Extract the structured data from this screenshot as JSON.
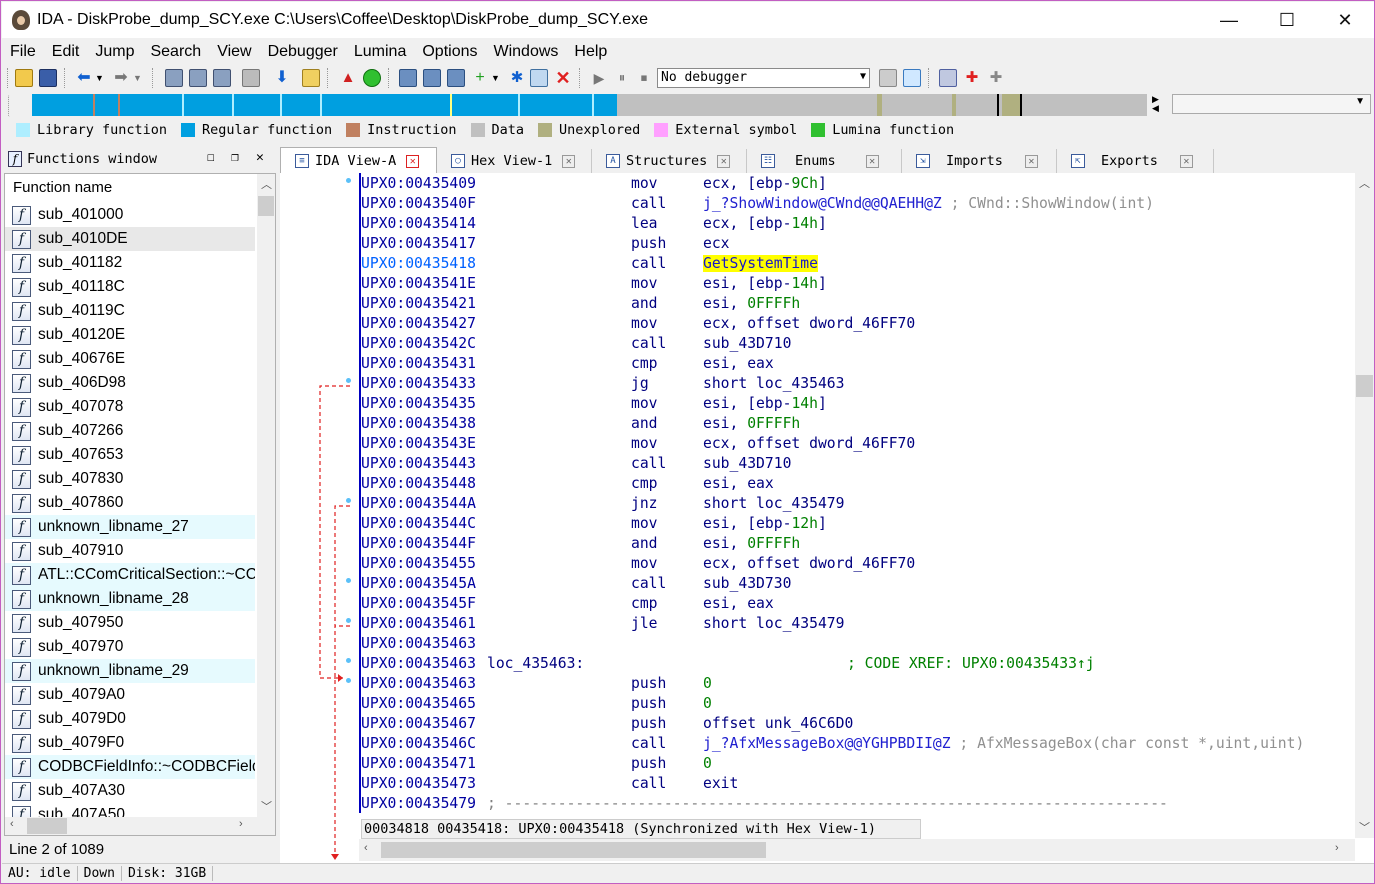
{
  "window": {
    "title": "IDA - DiskProbe_dump_SCY.exe C:\\Users\\Coffee\\Desktop\\DiskProbe_dump_SCY.exe",
    "minimize": "—",
    "maximize": "☐",
    "close": "✕"
  },
  "menu": [
    "File",
    "Edit",
    "Jump",
    "Search",
    "View",
    "Debugger",
    "Lumina",
    "Options",
    "Windows",
    "Help"
  ],
  "toolbar": {
    "debugger_select": "No debugger"
  },
  "legend": [
    {
      "label": "Library function",
      "color": "#aeeeff"
    },
    {
      "label": "Regular function",
      "color": "#009fe0"
    },
    {
      "label": "Instruction",
      "color": "#c08060"
    },
    {
      "label": "Data",
      "color": "#c0c0c0"
    },
    {
      "label": "Unexplored",
      "color": "#b0b080"
    },
    {
      "label": "External symbol",
      "color": "#ffa0ff"
    },
    {
      "label": "Lumina function",
      "color": "#30c030"
    }
  ],
  "functions_window": {
    "title": "Functions window",
    "column": "Function name",
    "items": [
      {
        "name": "sub_401000",
        "lib": false
      },
      {
        "name": "sub_4010DE",
        "lib": false,
        "selected": true
      },
      {
        "name": "sub_401182",
        "lib": false
      },
      {
        "name": "sub_40118C",
        "lib": false
      },
      {
        "name": "sub_40119C",
        "lib": false
      },
      {
        "name": "sub_40120E",
        "lib": false
      },
      {
        "name": "sub_40676E",
        "lib": false
      },
      {
        "name": "sub_406D98",
        "lib": false
      },
      {
        "name": "sub_407078",
        "lib": false
      },
      {
        "name": "sub_407266",
        "lib": false
      },
      {
        "name": "sub_407653",
        "lib": false
      },
      {
        "name": "sub_407830",
        "lib": false
      },
      {
        "name": "sub_407860",
        "lib": false
      },
      {
        "name": "unknown_libname_27",
        "lib": true
      },
      {
        "name": "sub_407910",
        "lib": false
      },
      {
        "name": "ATL::CComCriticalSection::~CComCriticalSection(void)",
        "lib": true
      },
      {
        "name": "unknown_libname_28",
        "lib": true
      },
      {
        "name": "sub_407950",
        "lib": false
      },
      {
        "name": "sub_407970",
        "lib": false
      },
      {
        "name": "unknown_libname_29",
        "lib": true
      },
      {
        "name": "sub_4079A0",
        "lib": false
      },
      {
        "name": "sub_4079D0",
        "lib": false
      },
      {
        "name": "sub_4079F0",
        "lib": false
      },
      {
        "name": "CODBCFieldInfo::~CODBCFieldInfo(void)",
        "lib": true
      },
      {
        "name": "sub_407A30",
        "lib": false
      },
      {
        "name": "sub_407A50",
        "lib": false
      }
    ],
    "status": "Line 2 of 1089"
  },
  "tabs": [
    {
      "label": "IDA View-A",
      "icon": "ida-view-icon",
      "active": true
    },
    {
      "label": "Hex View-1",
      "icon": "hex-view-icon"
    },
    {
      "label": "Structures",
      "icon": "structures-icon"
    },
    {
      "label": "Enums",
      "icon": "enums-icon"
    },
    {
      "label": "Imports",
      "icon": "imports-icon"
    },
    {
      "label": "Exports",
      "icon": "exports-icon"
    }
  ],
  "listing": [
    {
      "addr": "UPX0:00435409",
      "mn": "mov",
      "op": [
        [
          "ecx, [ebp-",
          ""
        ],
        [
          "9Ch",
          "num"
        ],
        [
          "]",
          ""
        ]
      ]
    },
    {
      "addr": "UPX0:0043540F",
      "mn": "call",
      "op": [
        [
          "j_?ShowWindow@CWnd@@QAEHH@Z",
          "sym"
        ],
        [
          " ; CWnd::ShowWindow(int)",
          "cmt"
        ]
      ]
    },
    {
      "addr": "UPX0:00435414",
      "mn": "lea",
      "op": [
        [
          "ecx, [ebp-",
          ""
        ],
        [
          "14h",
          "num"
        ],
        [
          "]",
          ""
        ]
      ]
    },
    {
      "addr": "UPX0:00435417",
      "mn": "push",
      "op": [
        [
          "ecx",
          ""
        ]
      ]
    },
    {
      "addr": "UPX0:00435418",
      "mn": "call",
      "op": [
        [
          "GetSystemTime",
          "hl"
        ]
      ],
      "current": true
    },
    {
      "addr": "UPX0:0043541E",
      "mn": "mov",
      "op": [
        [
          "esi, [ebp-",
          ""
        ],
        [
          "14h",
          "num"
        ],
        [
          "]",
          ""
        ]
      ]
    },
    {
      "addr": "UPX0:00435421",
      "mn": "and",
      "op": [
        [
          "esi, ",
          ""
        ],
        [
          "0FFFFh",
          "num"
        ]
      ]
    },
    {
      "addr": "UPX0:00435427",
      "mn": "mov",
      "op": [
        [
          "ecx, offset dword_46FF70",
          ""
        ]
      ]
    },
    {
      "addr": "UPX0:0043542C",
      "mn": "call",
      "op": [
        [
          "sub_43D710",
          ""
        ]
      ]
    },
    {
      "addr": "UPX0:00435431",
      "mn": "cmp",
      "op": [
        [
          "esi, eax",
          ""
        ]
      ]
    },
    {
      "addr": "UPX0:00435433",
      "mn": "jg",
      "op": [
        [
          "short loc_435463",
          ""
        ]
      ]
    },
    {
      "addr": "UPX0:00435435",
      "mn": "mov",
      "op": [
        [
          "esi, [ebp-",
          ""
        ],
        [
          "14h",
          "num"
        ],
        [
          "]",
          ""
        ]
      ]
    },
    {
      "addr": "UPX0:00435438",
      "mn": "and",
      "op": [
        [
          "esi, ",
          ""
        ],
        [
          "0FFFFh",
          "num"
        ]
      ]
    },
    {
      "addr": "UPX0:0043543E",
      "mn": "mov",
      "op": [
        [
          "ecx, offset dword_46FF70",
          ""
        ]
      ]
    },
    {
      "addr": "UPX0:00435443",
      "mn": "call",
      "op": [
        [
          "sub_43D710",
          ""
        ]
      ]
    },
    {
      "addr": "UPX0:00435448",
      "mn": "cmp",
      "op": [
        [
          "esi, eax",
          ""
        ]
      ]
    },
    {
      "addr": "UPX0:0043544A",
      "mn": "jnz",
      "op": [
        [
          "short loc_435479",
          ""
        ]
      ]
    },
    {
      "addr": "UPX0:0043544C",
      "mn": "mov",
      "op": [
        [
          "esi, [ebp-",
          ""
        ],
        [
          "12h",
          "num"
        ],
        [
          "]",
          ""
        ]
      ]
    },
    {
      "addr": "UPX0:0043544F",
      "mn": "and",
      "op": [
        [
          "esi, ",
          ""
        ],
        [
          "0FFFFh",
          "num"
        ]
      ]
    },
    {
      "addr": "UPX0:00435455",
      "mn": "mov",
      "op": [
        [
          "ecx, offset dword_46FF70",
          ""
        ]
      ]
    },
    {
      "addr": "UPX0:0043545A",
      "mn": "call",
      "op": [
        [
          "sub_43D730",
          ""
        ]
      ]
    },
    {
      "addr": "UPX0:0043545F",
      "mn": "cmp",
      "op": [
        [
          "esi, eax",
          ""
        ]
      ]
    },
    {
      "addr": "UPX0:00435461",
      "mn": "jle",
      "op": [
        [
          "short loc_435479",
          ""
        ]
      ]
    },
    {
      "addr": "UPX0:00435463",
      "mn": "",
      "op": []
    },
    {
      "addr": "UPX0:00435463",
      "label": "loc_435463:",
      "xref": "; CODE XREF: UPX0:00435433↑j"
    },
    {
      "addr": "UPX0:00435463",
      "mn": "push",
      "op": [
        [
          "0",
          "num"
        ]
      ]
    },
    {
      "addr": "UPX0:00435465",
      "mn": "push",
      "op": [
        [
          "0",
          "num"
        ]
      ]
    },
    {
      "addr": "UPX0:00435467",
      "mn": "push",
      "op": [
        [
          "offset unk_46C6D0",
          ""
        ]
      ]
    },
    {
      "addr": "UPX0:0043546C",
      "mn": "call",
      "op": [
        [
          "j_?AfxMessageBox@@YGHPBDII@Z",
          "sym"
        ],
        [
          " ; AfxMessageBox(char const *,uint,uint)",
          "cmt"
        ]
      ]
    },
    {
      "addr": "UPX0:00435471",
      "mn": "push",
      "op": [
        [
          "0",
          "num"
        ]
      ]
    },
    {
      "addr": "UPX0:00435473",
      "mn": "call",
      "op": [
        [
          "exit",
          ""
        ]
      ]
    },
    {
      "addr": "UPX0:00435479",
      "separator": "; ---------------------------------------------------------------------------"
    }
  ],
  "sync_status": "00034818 00435418: UPX0:00435418 (Synchronized with Hex View-1)",
  "statusbar": {
    "au": "AU:  idle",
    "dir": "Down",
    "disk": "Disk: 31GB"
  }
}
